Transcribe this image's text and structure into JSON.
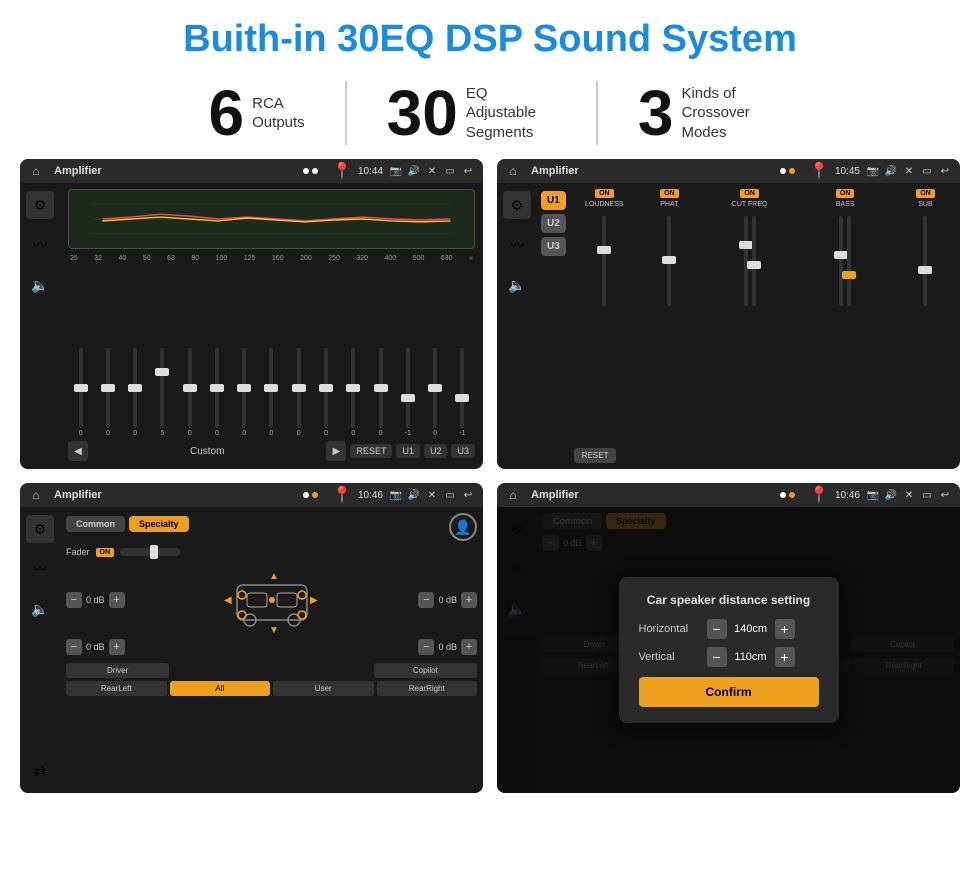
{
  "header": {
    "title": "Buith-in 30EQ DSP Sound System"
  },
  "stats": [
    {
      "number": "6",
      "label": "RCA\nOutputs"
    },
    {
      "number": "30",
      "label": "EQ Adjustable\nSegments"
    },
    {
      "number": "3",
      "label": "Kinds of\nCrossover Modes"
    }
  ],
  "screens": [
    {
      "id": "screen1",
      "status_title": "Amplifier",
      "time": "10:44",
      "preset": "Custom",
      "presets": [
        "RESET",
        "U1",
        "U2",
        "U3"
      ],
      "freqs": [
        "25",
        "32",
        "40",
        "50",
        "63",
        "80",
        "100",
        "125",
        "160",
        "200",
        "250",
        "320",
        "400",
        "500",
        "630"
      ],
      "values": [
        "0",
        "0",
        "0",
        "5",
        "0",
        "0",
        "0",
        "0",
        "0",
        "0",
        "0",
        "0",
        "-1",
        "0",
        "-1"
      ]
    },
    {
      "id": "screen2",
      "status_title": "Amplifier",
      "time": "10:45",
      "presets": [
        "U1",
        "U2",
        "U3"
      ],
      "channels": [
        {
          "label": "LOUDNESS",
          "on": true
        },
        {
          "label": "PHAT",
          "on": true
        },
        {
          "label": "CUT FREQ",
          "on": true
        },
        {
          "label": "BASS",
          "on": true
        },
        {
          "label": "SUB",
          "on": true
        }
      ],
      "reset_label": "RESET"
    },
    {
      "id": "screen3",
      "status_title": "Amplifier",
      "time": "10:46",
      "tabs": [
        "Common",
        "Specialty"
      ],
      "active_tab": "Specialty",
      "fader_label": "Fader",
      "fader_on": true,
      "db_values": [
        "0 dB",
        "0 dB",
        "0 dB",
        "0 dB"
      ],
      "btns": [
        "Driver",
        "",
        "All",
        "",
        "User",
        "",
        "Copilot",
        "RearLeft",
        "",
        "RearRight"
      ]
    },
    {
      "id": "screen4",
      "status_title": "Amplifier",
      "time": "10:46",
      "dialog": {
        "title": "Car speaker distance setting",
        "horizontal_label": "Horizontal",
        "horizontal_value": "140cm",
        "vertical_label": "Vertical",
        "vertical_value": "110cm",
        "confirm_label": "Confirm"
      }
    }
  ]
}
